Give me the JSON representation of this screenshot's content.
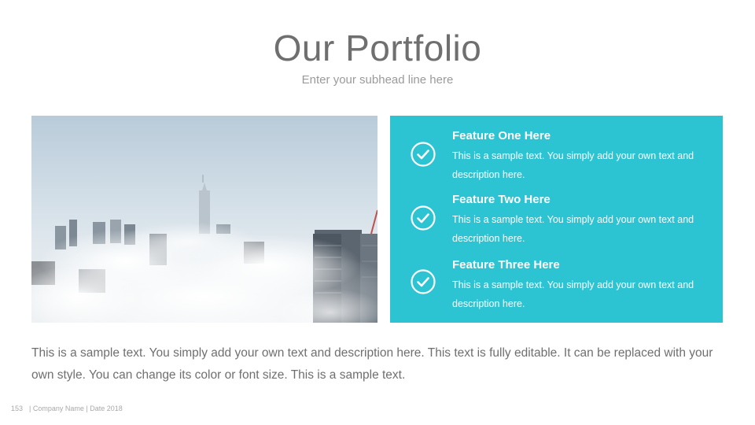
{
  "title": "Our Portfolio",
  "subtitle": "Enter your subhead line here",
  "features": [
    {
      "title": "Feature One Here",
      "desc": "This is a sample text. You simply add your own text and description here."
    },
    {
      "title": "Feature Two Here",
      "desc": "This is a sample text. You simply add your own text and description here."
    },
    {
      "title": "Feature Three Here",
      "desc": "This is a sample text. You simply add your own text and description here."
    }
  ],
  "body_text": "This is a sample text. You simply add your own text and description here. This text is fully editable. It can be replaced with your own style. You can change its color or font size. This is a sample text.",
  "footer": {
    "page_number": "153",
    "label": "| Company Name | Date 2018"
  },
  "colors": {
    "accent": "#2cc3d3",
    "title": "#6f6f6f",
    "subtitle": "#9a9a9a"
  },
  "icons": {
    "feature": "check-circle-icon"
  }
}
